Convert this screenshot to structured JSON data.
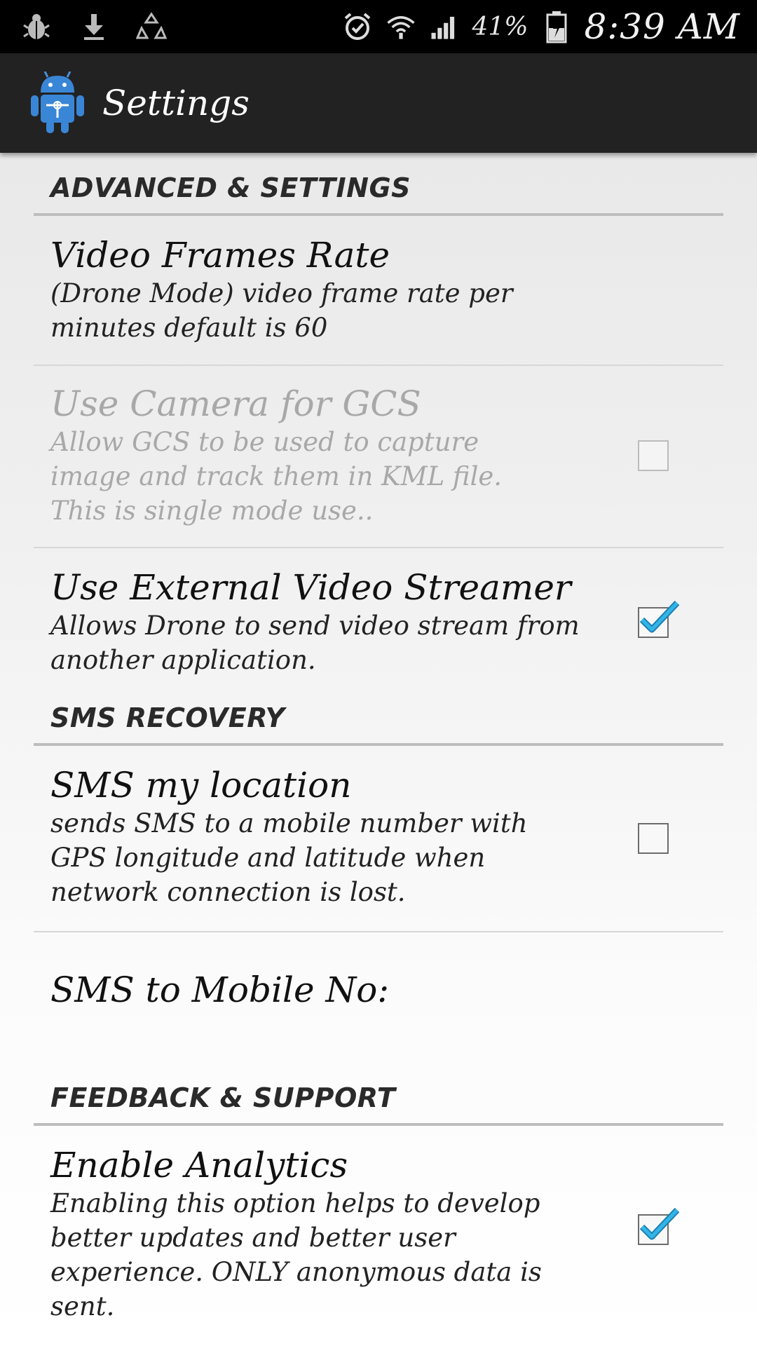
{
  "status_bar": {
    "left_icons": [
      "bug-icon",
      "download-icon",
      "recycle-icon"
    ],
    "right_icons": [
      "alarm-icon",
      "wifi-icon",
      "signal-icon",
      "battery-icon"
    ],
    "battery_text": "41%",
    "time": "8:39 AM"
  },
  "action_bar": {
    "title": "Settings",
    "app_icon": "android-drone-app-icon"
  },
  "sections": {
    "advanced": {
      "header": "ADVANCED & SETTINGS",
      "video_frames": {
        "title": "Video Frames Rate",
        "summary": "(Drone Mode) video frame rate per minutes default is 60"
      },
      "camera_gcs": {
        "title": "Use Camera for GCS",
        "summary": "Allow GCS to be used to capture image and track them in KML file. This is single mode use..",
        "checked": false,
        "enabled": false
      },
      "external_video": {
        "title": "Use External Video Streamer",
        "summary": "Allows Drone to send video stream from another application.",
        "checked": true
      }
    },
    "sms": {
      "header": "SMS RECOVERY",
      "sms_location": {
        "title": "SMS my location",
        "summary": "sends SMS to a mobile number with GPS longitude and latitude when network connection is lost.",
        "checked": false
      },
      "sms_mobile": {
        "title": "SMS to Mobile No:"
      }
    },
    "feedback": {
      "header": "FEEDBACK & SUPPORT",
      "analytics": {
        "title": "Enable Analytics",
        "summary": "Enabling this option helps to develop better updates and better user experience. ONLY anonymous data is sent.",
        "checked": true
      }
    }
  },
  "colors": {
    "status_bar": "#000000",
    "action_bar": "#222222",
    "checkmark": "#33b5e5"
  }
}
